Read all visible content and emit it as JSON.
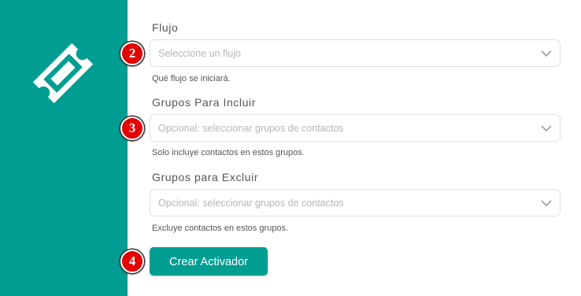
{
  "sidebar": {
    "icon": "ticket-icon",
    "color": "#009d92"
  },
  "form": {
    "fields": [
      {
        "label": "Flujo",
        "placeholder": "Seleccione un flujo",
        "help": "Qué flujo se iniciará.",
        "marker": "2"
      },
      {
        "label": "Grupos Para Incluir",
        "placeholder": "Opcional: seleccionar grupos de contactos",
        "help": "Solo incluye contactos en estos grupos.",
        "marker": "3"
      },
      {
        "label": "Grupos para Excluir",
        "placeholder": "Opcional: seleccionar grupos de contactos",
        "help": "Excluye contactos en estos grupos."
      }
    ],
    "submit_label": "Crear Activador",
    "submit_marker": "4"
  },
  "colors": {
    "accent": "#009d92",
    "marker": "#e20000"
  }
}
